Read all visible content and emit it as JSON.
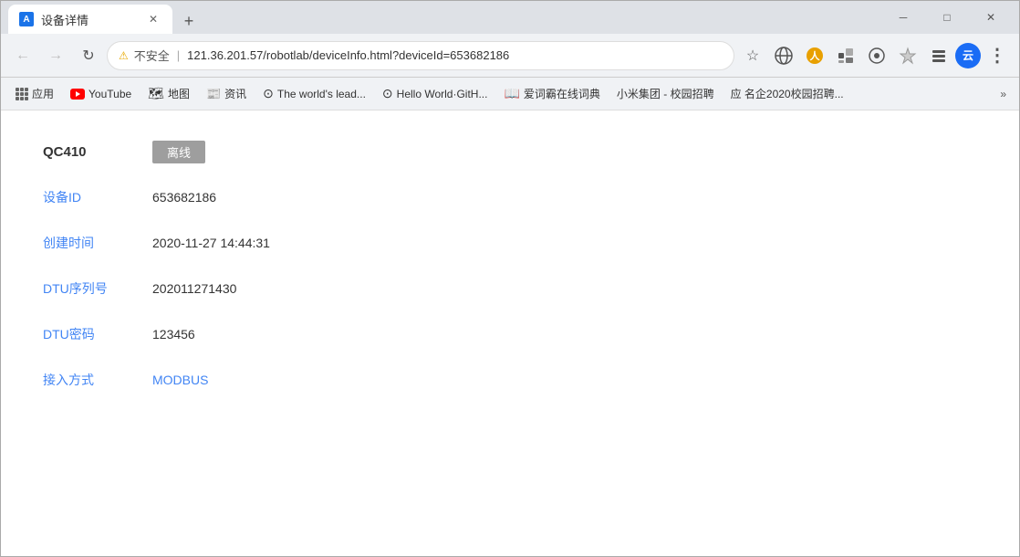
{
  "browser": {
    "tab": {
      "title": "设备详情",
      "icon": "A"
    },
    "new_tab_label": "+",
    "window_controls": {
      "minimize": "－",
      "maximize": "□",
      "close": "✕"
    },
    "address_bar": {
      "back_icon": "←",
      "forward_icon": "→",
      "refresh_icon": "↻",
      "security_label": "不安全",
      "url": "121.36.201.57/robotlab/deviceInfo.html?deviceId=653682186",
      "star_icon": "☆",
      "menu_icon": "⋮"
    },
    "bookmarks": [
      {
        "id": "apps",
        "label": "应用",
        "type": "apps"
      },
      {
        "id": "youtube",
        "label": "YouTube",
        "type": "youtube"
      },
      {
        "id": "maps",
        "label": "地图",
        "type": "maps"
      },
      {
        "id": "news",
        "label": "资讯",
        "type": "text"
      },
      {
        "id": "github",
        "label": "The world's lead...",
        "type": "github"
      },
      {
        "id": "hello",
        "label": "Hello World·GitH...",
        "type": "github2"
      },
      {
        "id": "dict",
        "label": "爱词霸在线词典",
        "type": "dict"
      },
      {
        "id": "xiaomi",
        "label": "小米集团 - 校园招聘",
        "type": "text"
      },
      {
        "id": "campus",
        "label": "应  名企2020校园招聘...",
        "type": "text"
      }
    ],
    "more_bookmarks": "»"
  },
  "page": {
    "device_name": "QC410",
    "status_label": "离线",
    "fields": [
      {
        "label": "设备ID",
        "value": "653682186",
        "value_class": "normal"
      },
      {
        "label": "创建时间",
        "value": "2020-11-27 14:44:31",
        "value_class": "normal"
      },
      {
        "label": "DTU序列号",
        "value": "202011271430",
        "value_class": "normal"
      },
      {
        "label": "DTU密码",
        "value": "123456",
        "value_class": "normal"
      },
      {
        "label": "接入方式",
        "value": "MODBUS",
        "value_class": "blue"
      }
    ]
  },
  "colors": {
    "label": "#4285f4",
    "status_bg": "#9e9e9e",
    "modbus": "#4285f4"
  }
}
